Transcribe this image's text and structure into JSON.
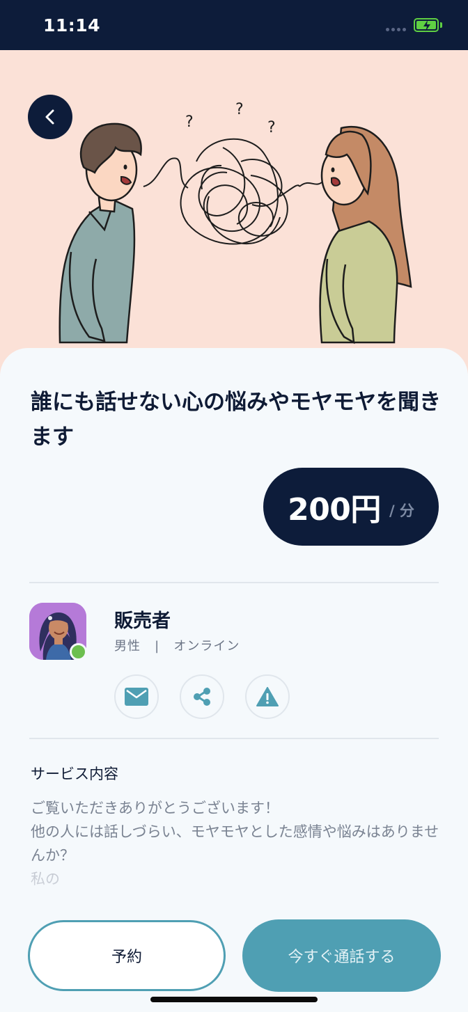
{
  "status_bar": {
    "time": "11:14",
    "battery_state": "charging",
    "accent_color": "#5fcf43"
  },
  "hero": {
    "background_color": "#fbe1d7",
    "illustration": "two-people-tangled-conversation-illustration",
    "question_marks": [
      "?",
      "?",
      "?"
    ]
  },
  "navigation": {
    "back_icon": "chevron-left-icon"
  },
  "service": {
    "title": "誰にも話せない心の悩みやモヤモヤを聞きます",
    "price_amount": "200円",
    "price_unit": "/ 分"
  },
  "seller": {
    "name": "販売者",
    "gender": "男性",
    "status": "オンライン",
    "meta_separator": "|",
    "online": true,
    "actions": [
      {
        "icon": "mail-icon",
        "name": "message"
      },
      {
        "icon": "share-icon",
        "name": "share"
      },
      {
        "icon": "warning-icon",
        "name": "report"
      }
    ]
  },
  "details": {
    "heading": "サービス内容",
    "lines": [
      "ご覧いただきありがとうございます！",
      "他の人には話しづらい、モヤモヤとした感情や悩みはありませんか？",
      "私の"
    ]
  },
  "buttons": {
    "reserve": "予約",
    "call_now": "今すぐ通話する"
  },
  "colors": {
    "navy": "#0d1c3a",
    "teal": "#4f9fb3",
    "online_green": "#6cbf4f"
  }
}
